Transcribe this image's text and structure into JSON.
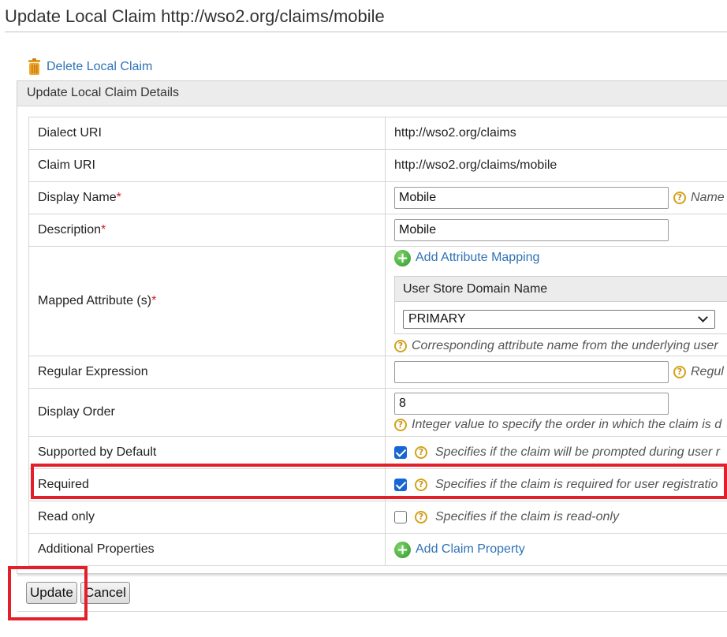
{
  "page": {
    "title": "Update Local Claim http://wso2.org/claims/mobile"
  },
  "actions": {
    "delete_label": "Delete Local Claim"
  },
  "panel": {
    "header": "Update Local Claim Details"
  },
  "rows": {
    "dialect_uri": {
      "label": "Dialect URI",
      "value": "http://wso2.org/claims"
    },
    "claim_uri": {
      "label": "Claim URI",
      "value": "http://wso2.org/claims/mobile"
    },
    "display_name": {
      "label": "Display Name",
      "required_mark": "*",
      "value": "Mobile",
      "hint": "Name"
    },
    "description": {
      "label": "Description",
      "required_mark": "*",
      "value": "Mobile"
    },
    "mapped_attributes": {
      "label": "Mapped Attribute (s)",
      "required_mark": "*",
      "add_label": "Add Attribute Mapping",
      "column_header": "User Store Domain Name",
      "selected_domain": "PRIMARY",
      "hint": "Corresponding attribute name from the underlying user"
    },
    "regex": {
      "label": "Regular Expression",
      "value": "",
      "hint": "Regul"
    },
    "display_order": {
      "label": "Display Order",
      "value": "8",
      "hint": "Integer value to specify the order in which the claim is d"
    },
    "supported": {
      "label": "Supported by Default",
      "checked": true,
      "hint": "Specifies if the claim will be prompted during user r"
    },
    "required": {
      "label": "Required",
      "checked": true,
      "hint": "Specifies if the claim is required for user registratio"
    },
    "read_only": {
      "label": "Read only",
      "checked": false,
      "hint": "Specifies if the claim is read-only"
    },
    "additional": {
      "label": "Additional Properties",
      "add_label": "Add Claim Property"
    }
  },
  "buttons": {
    "update": "Update",
    "cancel": "Cancel"
  },
  "help_glyph": "?",
  "plus_glyph": "+",
  "colors": {
    "link": "#2f73b6",
    "highlight": "#e3202a",
    "required": "#d01c1c",
    "help": "#d3a318",
    "checkbox": "#1766d3"
  }
}
